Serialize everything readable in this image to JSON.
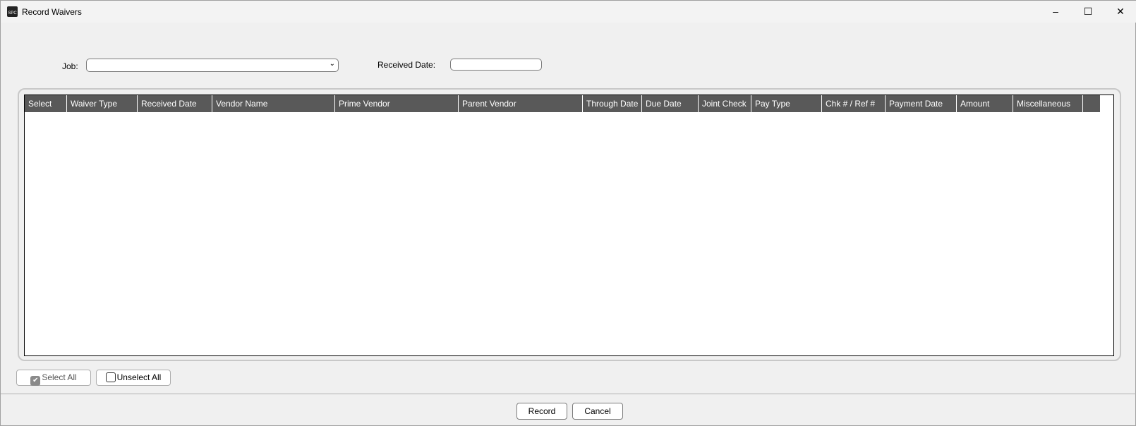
{
  "window": {
    "title": "Record Waivers",
    "icon": "app-logo-icon"
  },
  "filters": {
    "job_label": "Job:",
    "job_value": "",
    "received_date_label": "Received Date:",
    "received_date_value": ""
  },
  "grid": {
    "columns": [
      "Select",
      "Waiver Type",
      "Received Date",
      "Vendor Name",
      "Prime Vendor",
      "Parent Vendor",
      "Through Date",
      "Due Date",
      "Joint Check",
      "Pay Type",
      "Chk # / Ref #",
      "Payment Date",
      "Amount",
      "Miscellaneous",
      ""
    ],
    "rows": []
  },
  "buttons": {
    "select_all": "Select All",
    "unselect_all": "Unselect All",
    "record": "Record",
    "cancel": "Cancel"
  },
  "colors": {
    "header_bg": "#595959",
    "window_bg": "#f0f0f0"
  }
}
